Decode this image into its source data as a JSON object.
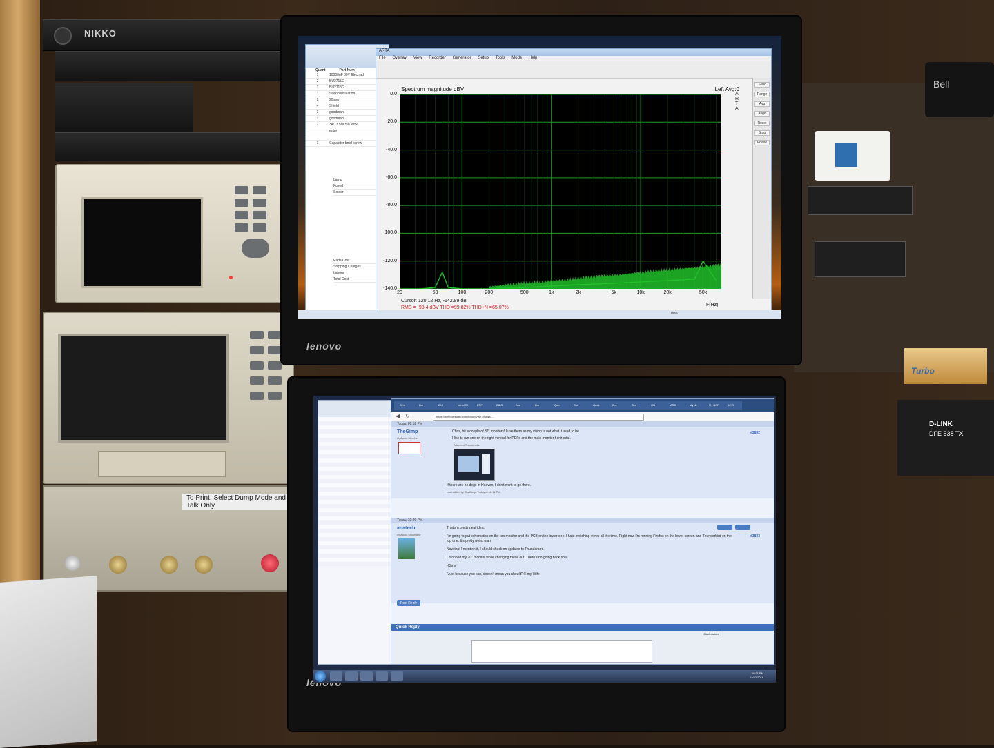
{
  "scene": {
    "left_instruments": {
      "top_rack_brand": "NIKKO",
      "print_instruction": "To Print, Select Dump Mode and Talk Only"
    },
    "stickers": {
      "bell": "Bell",
      "dlink": "D-LINK",
      "dlink_model": "DFE 538 TX",
      "turbo_box": "Turbo"
    },
    "monitor_brand": "lenovo"
  },
  "top_screen": {
    "spreadsheet": {
      "header": [
        "Quant",
        "Part Num"
      ],
      "rows": [
        [
          "1",
          "10000uF 80V Elec rad"
        ],
        [
          "2",
          "BU2715G"
        ],
        [
          "1",
          "BU2715G"
        ],
        [
          "1",
          "Silicon insulation"
        ],
        [
          "2",
          "20mm"
        ],
        [
          "4",
          "Shield"
        ],
        [
          "3",
          "goodman"
        ],
        [
          "1",
          "goodman"
        ],
        [
          "2",
          "34/13 5W 5% WW"
        ],
        [
          "",
          "entry"
        ],
        [
          "",
          ""
        ],
        [
          "1",
          "Capacitor brnd screw"
        ]
      ],
      "footer_labels": [
        "Lamp",
        "Fused",
        "Solder"
      ],
      "totals": [
        "Parts Cost",
        "Shipping Charges",
        "Labour",
        "Total Cost"
      ]
    },
    "arta": {
      "window_title": "ARTA",
      "menus": [
        "File",
        "Overlay",
        "View",
        "Recorder",
        "Generator",
        "Setup",
        "Tools",
        "Mode",
        "Help"
      ],
      "vertical_label": "ARTA",
      "side_buttons": [
        "Sync",
        "Range",
        "Avg",
        "Avgd",
        "Reset",
        "Stop",
        "Phase"
      ]
    },
    "chart_data": {
      "type": "line",
      "title": "Spectrum magnitude dBV",
      "channel_info": "Left  Avg:0",
      "ylabel": "",
      "xlabel": "F(Hz)",
      "x_scale": "log",
      "xlim": [
        20,
        80000
      ],
      "ylim": [
        -140,
        0
      ],
      "yticks": [
        "0.0",
        "-20.0",
        "-40.0",
        "-60.0",
        "-80.0",
        "-100.0",
        "-120.0",
        "-140.0"
      ],
      "xticks": [
        "20",
        "50",
        "100",
        "200",
        "500",
        "1k",
        "2k",
        "5k",
        "10k",
        "20k",
        "50k"
      ],
      "grid": true,
      "series": [
        {
          "color": "#22c02a",
          "x": [
            20,
            35,
            50,
            60,
            70,
            100,
            200,
            500,
            1000,
            2000,
            5000,
            10000,
            20000,
            40000,
            50000,
            70000
          ],
          "y": [
            -140,
            -140,
            -139,
            -128,
            -139,
            -140,
            -140,
            -139,
            -138,
            -137,
            -136,
            -135,
            -134,
            -133,
            -120,
            -134
          ]
        }
      ],
      "cursor_readout": "Cursor: 120.12 Hz, -142.89 dB",
      "measurements": "RMS = -98.4 dBV  THD =99.82%  THD+N =65.07%"
    },
    "zoom": "100%"
  },
  "bottom_screen": {
    "browser": {
      "url": "https://www.diyaudio.com/forums/the-lounge/...",
      "tab_labels": [
        "Sym",
        "Bur",
        "200",
        "Ide of El",
        "ESP",
        "BIZO",
        "Ass",
        "Bru",
        "Quo",
        "Dis",
        "Ques",
        "Dro",
        "Tec",
        "GN",
        "ARD",
        "My dil",
        "My NSP",
        "LEO"
      ]
    },
    "posts": [
      {
        "date": "Today, 09:52 PM",
        "username": "TheGimp",
        "role": "diyAudio Member",
        "text": "Chris, hit a couple of 32\" monitors! I use them as my vision is not what it used to be.",
        "text2": "I like to run one on the right vertical for PDFs and the main monitor horizontal.",
        "attachment": "Attached Thumbnails",
        "signature": "If there are no dogs in Heaven, I don't want to go there.",
        "edited": "Last edited by TheGimp; Today at 10:11 PM.",
        "number": "#3832"
      },
      {
        "date": "Today, 10:20 PM",
        "username": "anatech",
        "role": "diyAudio Moderator",
        "paragraphs": [
          "That's a pretty neat idea.",
          "I'm going to put schematics on the top monitor and the PCB on the lower one. I hate switching views all the time. Right now I'm running Firefox on the lower screen and Thunderbird on the top one. It's pretty weird man!",
          "Now that I mention it, I should check on updates to Thunderbird.",
          "I dropped my 20\" monitor while changing these out. There's no going back now.",
          "-Chris",
          "\"Just because you can, doesn't mean you should\" © my Wife"
        ],
        "number": "#3833"
      }
    ],
    "post_reply_button": "Post Reply",
    "quick_reply_title": "Quick Reply",
    "moderation_label": "Moderation",
    "clock": {
      "time": "10:21 PM",
      "date": "12/22/2016"
    }
  }
}
